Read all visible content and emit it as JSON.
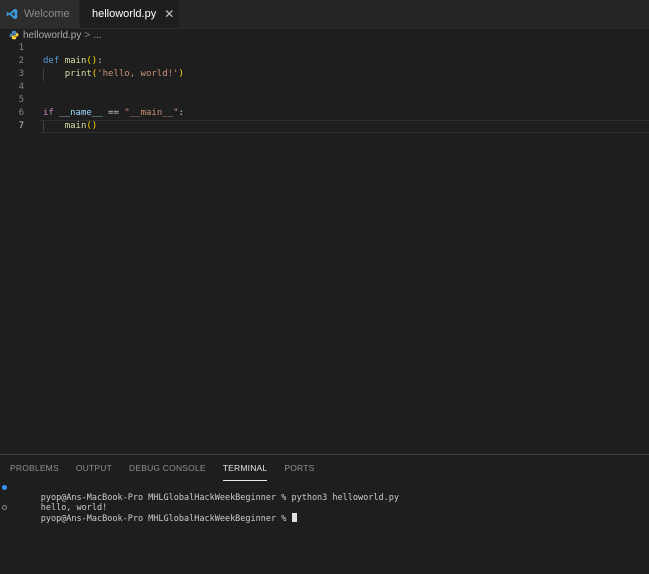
{
  "tabs": [
    {
      "label": "Welcome",
      "icon": "vscode-icon",
      "active": false
    },
    {
      "label": "helloworld.py",
      "icon": "python-file-icon",
      "active": true
    }
  ],
  "close_icon": "close-icon",
  "breadcrumb": {
    "file": "helloworld.py",
    "sep": ">",
    "more": "..."
  },
  "editor": {
    "line_numbers": [
      "1",
      "2",
      "3",
      "4",
      "5",
      "6",
      "7"
    ],
    "current_line": 7
  },
  "code": {
    "l2": {
      "kw": "def",
      "fn": "main",
      "open": "()",
      "colon": ":"
    },
    "l3": {
      "fn": "print",
      "open": "(",
      "str": "'hello, world!'",
      "close": ")"
    },
    "l6": {
      "kw": "if",
      "var": "__name__",
      "op": " == ",
      "str": "\"__main__\"",
      "colon": ":"
    },
    "l7": {
      "fn": "main",
      "open": "()"
    }
  },
  "panel": {
    "tabs": [
      "PROBLEMS",
      "OUTPUT",
      "DEBUG CONSOLE",
      "TERMINAL",
      "PORTS"
    ],
    "active_tab": "TERMINAL"
  },
  "terminal": {
    "line1": "pyop@Ans-MacBook-Pro MHLGlobalHackWeekBeginner % python3 helloworld.py",
    "line2": "hello, world!",
    "line3": "pyop@Ans-MacBook-Pro MHLGlobalHackWeekBeginner % "
  },
  "colors": {
    "keyword": "#569cd6",
    "function": "#dcdcaa",
    "string": "#ce9178",
    "variable": "#9cdcfe",
    "bracket": "#ffd700",
    "accent": "#3794ff"
  }
}
